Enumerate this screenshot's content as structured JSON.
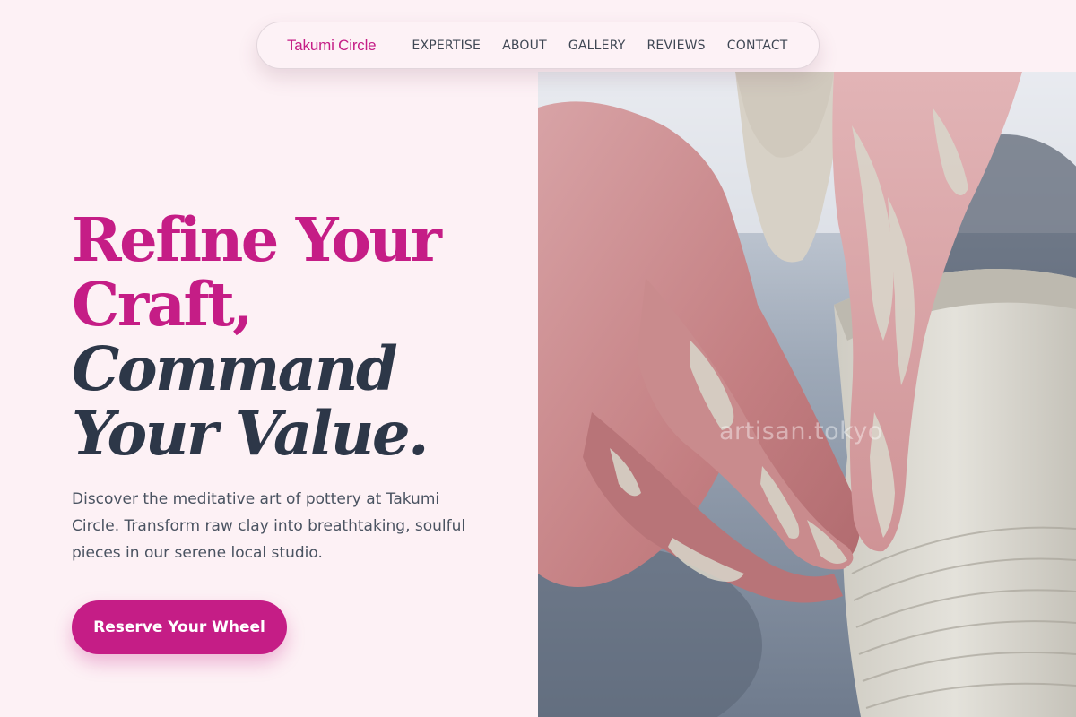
{
  "nav": {
    "brand": "Takumi Circle",
    "links": [
      "EXPERTISE",
      "ABOUT",
      "GALLERY",
      "REVIEWS",
      "CONTACT"
    ]
  },
  "hero": {
    "headline_line1": "Refine Your",
    "headline_line2": "Craft,",
    "headline_line3": "Command",
    "headline_line4": "Your Value.",
    "description": "Discover the meditative art of pottery at Takumi Circle. Transform raw clay into breathtaking, soulful pieces in our serene local studio.",
    "cta_label": "Reserve Your Wheel"
  },
  "image": {
    "subject": "hands shaping clay on a pottery wheel",
    "watermark": "artisan.tokyo"
  },
  "colors": {
    "accent": "#c51d86",
    "heading_dark": "#2d3748",
    "background": "#fdf1f5"
  }
}
